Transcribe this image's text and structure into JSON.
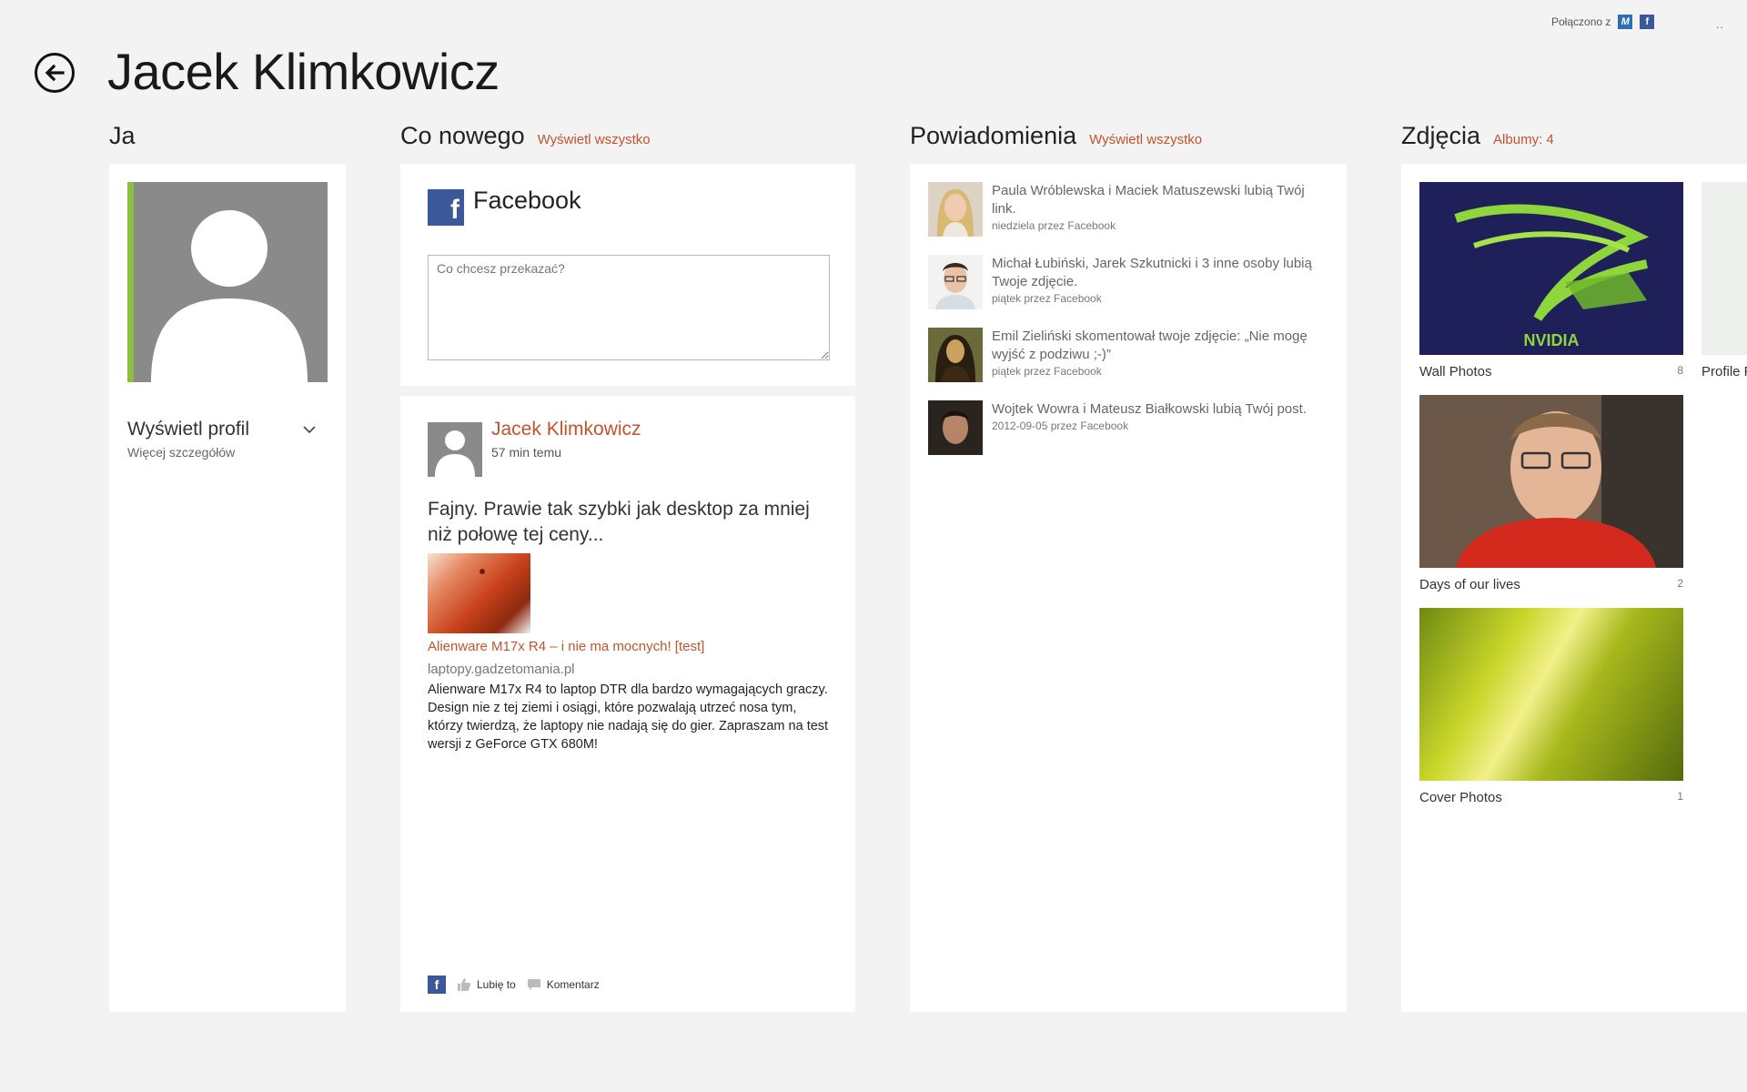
{
  "header": {
    "connected_label": "Połączono z",
    "dots": "..",
    "title": "Jacek Klimkowicz"
  },
  "sections": {
    "ja": {
      "title": "Ja"
    },
    "whats_new": {
      "title": "Co nowego",
      "link": "Wyświetl wszystko"
    },
    "notifications": {
      "title": "Powiadomienia",
      "link": "Wyświetl wszystko"
    },
    "photos": {
      "title": "Zdjęcia",
      "link": "Albumy: 4"
    }
  },
  "profile": {
    "link": "Wyświetl profil",
    "sub": "Więcej szczegółów"
  },
  "facebook": {
    "logo": "f",
    "title": "Facebook",
    "compose_placeholder": "Co chcesz przekazać?"
  },
  "post": {
    "author": "Jacek Klimkowicz",
    "time": "57 min temu",
    "text": "Fajny. Prawie tak szybki jak desktop za mniej niż połowę tej ceny...",
    "link_title": "Alienware M17x R4 – i nie ma mocnych! [test]",
    "link_domain": "laptopy.gadzetomania.pl",
    "link_desc": "Alienware M17x R4 to laptop DTR dla bardzo wymagających graczy. Design nie z tej ziemi i osiągi, które pozwalają utrzeć nosa tym, którzy twierdzą, że laptopy nie nadają się do gier. Zapraszam na test wersji z GeForce GTX 680M!",
    "like_label": "Lubię to",
    "comment_label": "Komentarz"
  },
  "notifications": [
    {
      "text": "Paula Wróblewska i Maciek Matuszewski lubią Twój link.",
      "meta": "niedziela przez Facebook"
    },
    {
      "text": "Michał Łubiński, Jarek Szkutnicki i 3 inne osoby lubią Twoje zdjęcie.",
      "meta": "piątek przez Facebook"
    },
    {
      "text": "Emil Zieliński skomentował twoje zdjęcie: „Nie mogę wyjść z podziwu ;-)”",
      "meta": "piątek przez Facebook"
    },
    {
      "text": "Wojtek Wowra i Mateusz Białkowski lubią Twój post.",
      "meta": "2012-09-05 przez Facebook"
    }
  ],
  "albums": [
    {
      "name": "Wall Photos",
      "count": "8"
    },
    {
      "name": "Days of our lives",
      "count": "2"
    },
    {
      "name": "Cover Photos",
      "count": "1"
    }
  ],
  "partial_album": {
    "name": "Profile P"
  },
  "colors": {
    "accent": "#c1542c",
    "facebook": "#3b5998",
    "profile_strip": "#8cbf3f",
    "background": "#f3f3f3"
  }
}
